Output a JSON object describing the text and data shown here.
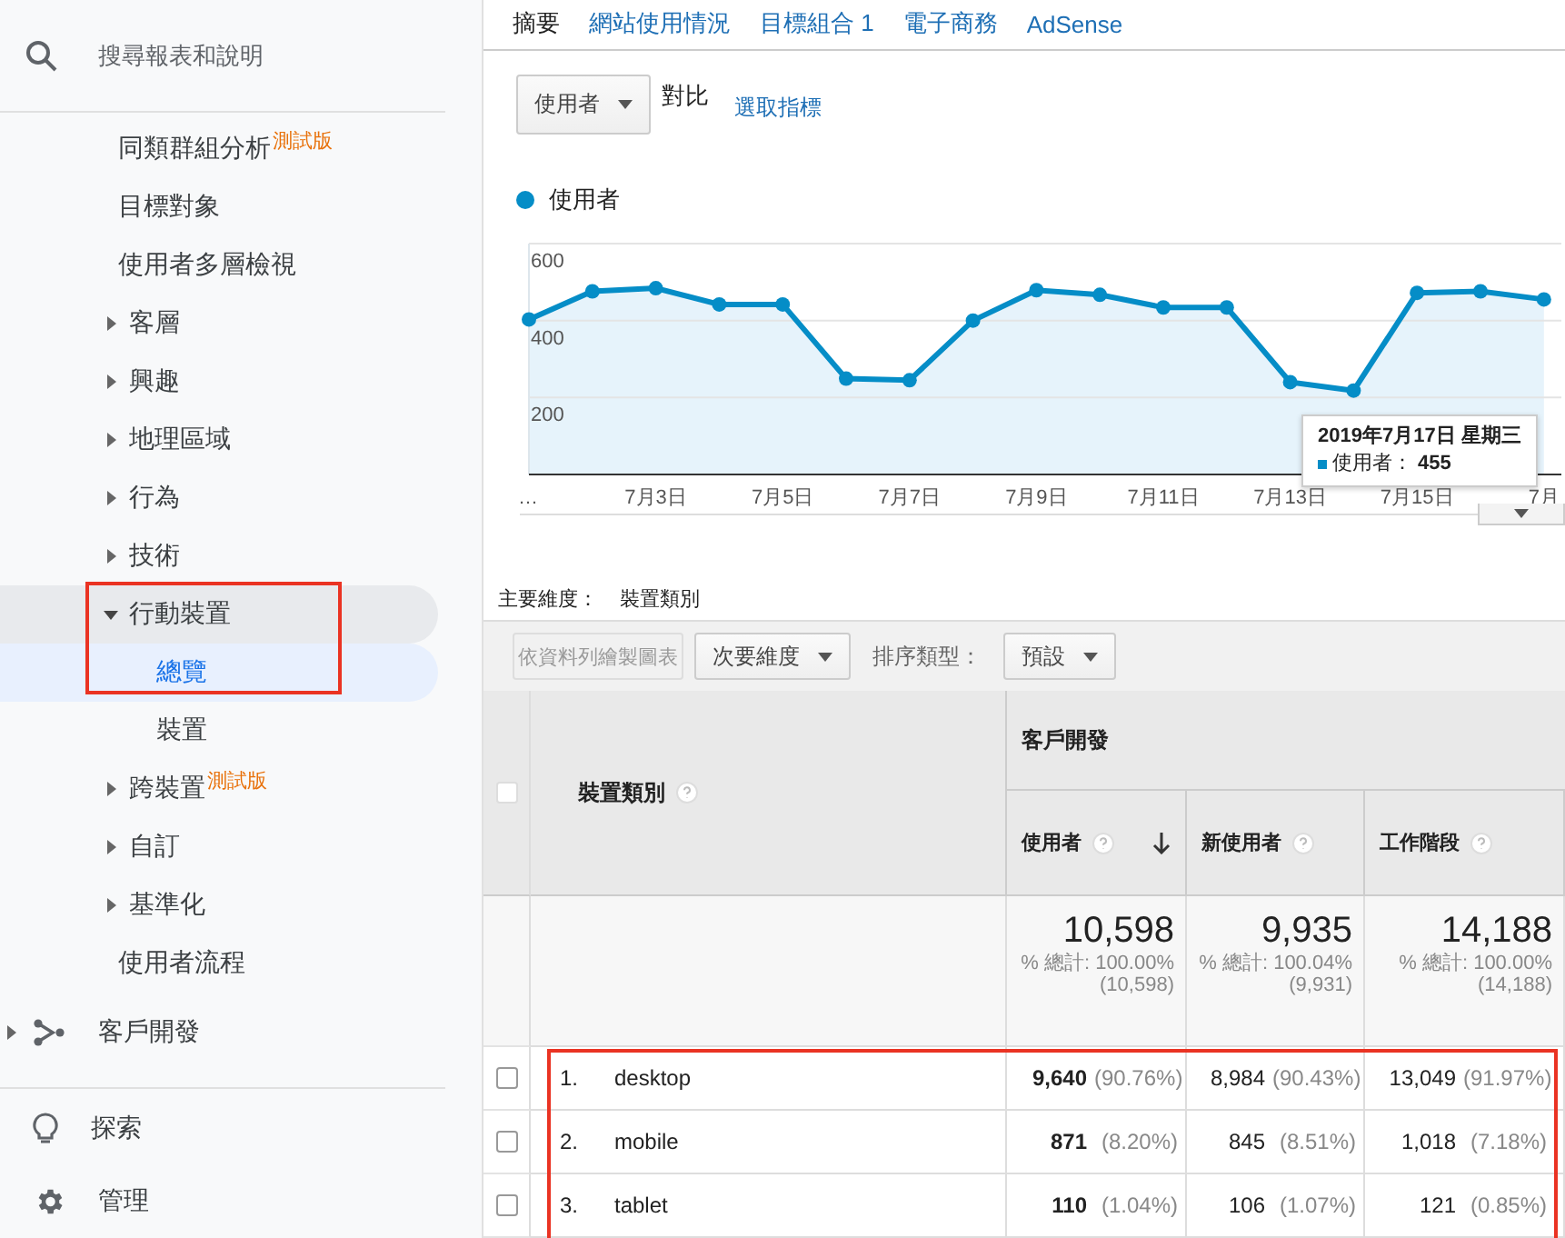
{
  "sidebar": {
    "search": {
      "placeholder": "搜尋報表和說明"
    },
    "items": [
      {
        "label": "同類群組分析",
        "kind": "link",
        "badge": "測試版"
      },
      {
        "label": "目標對象",
        "kind": "link"
      },
      {
        "label": "使用者多層檢視",
        "kind": "link"
      },
      {
        "label": "客層",
        "kind": "group",
        "expanded": false
      },
      {
        "label": "興趣",
        "kind": "group",
        "expanded": false
      },
      {
        "label": "地理區域",
        "kind": "group",
        "expanded": false
      },
      {
        "label": "行為",
        "kind": "group",
        "expanded": false
      },
      {
        "label": "技術",
        "kind": "group",
        "expanded": false
      },
      {
        "label": "行動裝置",
        "kind": "group",
        "expanded": true,
        "boxed": true,
        "children": [
          {
            "label": "總覽",
            "kind": "link",
            "selected": true,
            "boxed": true
          },
          {
            "label": "裝置",
            "kind": "link",
            "selected": false
          }
        ]
      },
      {
        "label": "跨裝置",
        "kind": "group",
        "expanded": false,
        "badge": "測試版"
      },
      {
        "label": "自訂",
        "kind": "group",
        "expanded": false
      },
      {
        "label": "基準化",
        "kind": "group",
        "expanded": false
      },
      {
        "label": "使用者流程",
        "kind": "link"
      }
    ],
    "sections": [
      {
        "label": "客戶開發",
        "expanded": false
      }
    ],
    "footer": [
      {
        "label": "探索"
      },
      {
        "label": "管理"
      }
    ]
  },
  "tabs": [
    {
      "label": "摘要",
      "selected": true
    },
    {
      "label": "網站使用情況",
      "selected": false
    },
    {
      "label": "目標組合 1",
      "selected": false
    },
    {
      "label": "電子商務",
      "selected": false
    },
    {
      "label": "AdSense",
      "selected": false
    }
  ],
  "metric_bar": {
    "metric": "使用者",
    "compare": "對比",
    "pick": "選取指標"
  },
  "chart": {
    "chart_data": {
      "type": "line",
      "categories": [
        "…",
        null,
        "7月3日",
        null,
        "7月5日",
        null,
        "7月7日",
        null,
        "7月9日",
        null,
        "7月11日",
        null,
        "7月13日",
        null,
        "7月15日",
        null,
        "7月"
      ],
      "series": [
        {
          "name": "使用者",
          "color": "#058dc7",
          "marker": true,
          "values": [
            403,
            476,
            484,
            442,
            442,
            249,
            245,
            400,
            479,
            467,
            434,
            434,
            240,
            218,
            472,
            476,
            455
          ]
        }
      ],
      "ylim": [
        0,
        600
      ],
      "yticks": [
        200,
        400,
        600
      ]
    },
    "tooltip": {
      "title": "2019年7月17日 星期三",
      "label": "使用者：",
      "value": "455"
    }
  },
  "dimension": {
    "label": "主要維度：",
    "value": "裝置類別"
  },
  "toolbar": {
    "chart_button": {
      "label": "依資料列繪製圖表",
      "disabled": true
    },
    "secondary": "次要維度",
    "sort_label": "排序類型：",
    "sort": "預設"
  },
  "table": {
    "dimension_header": "裝置類別",
    "group_header": "客戶開發",
    "select_all": {
      "disabled": true
    },
    "columns": [
      {
        "label": "使用者",
        "sorted": true
      },
      {
        "label": "新使用者",
        "sorted": false
      },
      {
        "label": "工作階段",
        "sorted": false
      }
    ],
    "totals": [
      {
        "value": "10,598",
        "share": "% 總計: 100.00%",
        "total": "(10,598)"
      },
      {
        "value": "9,935",
        "share": "% 總計: 100.04%",
        "total": "(9,931)"
      },
      {
        "value": "14,188",
        "share": "% 總計: 100.00%",
        "total": "(14,188)"
      }
    ],
    "rows": [
      {
        "index": "1.",
        "label": "desktop",
        "checked": false,
        "boxed": true,
        "cells": [
          {
            "value": "9,640",
            "pct": "(90.76%)"
          },
          {
            "value": "8,984",
            "pct": "(90.43%)"
          },
          {
            "value": "13,049",
            "pct": "(91.97%)"
          }
        ]
      },
      {
        "index": "2.",
        "label": "mobile",
        "checked": false,
        "boxed": true,
        "cells": [
          {
            "value": "871",
            "pct": "(8.20%)"
          },
          {
            "value": "845",
            "pct": "(8.51%)"
          },
          {
            "value": "1,018",
            "pct": "(7.18%)"
          }
        ]
      },
      {
        "index": "3.",
        "label": "tablet",
        "checked": false,
        "boxed": true,
        "cells": [
          {
            "value": "110",
            "pct": "(1.04%)"
          },
          {
            "value": "106",
            "pct": "(1.07%)"
          },
          {
            "value": "121",
            "pct": "(0.85%)"
          }
        ]
      }
    ]
  }
}
